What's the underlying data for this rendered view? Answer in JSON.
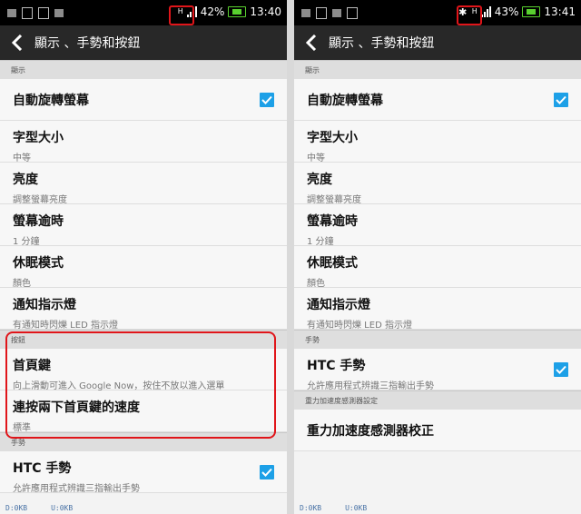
{
  "left": {
    "status": {
      "battery": "42%",
      "time": "13:40",
      "network_glyph": "H"
    },
    "title": "顯示 、手勢和按鈕",
    "sections": [
      {
        "header": "顯示",
        "rows": [
          {
            "title": "自動旋轉螢幕",
            "sub": null,
            "checkbox": true
          },
          {
            "title": "字型大小",
            "sub": "中等"
          },
          {
            "title": "亮度",
            "sub": "調整螢幕亮度"
          },
          {
            "title": "螢幕逾時",
            "sub": "1 分鐘"
          },
          {
            "title": "休眠模式",
            "sub": "顏色"
          },
          {
            "title": "通知指示燈",
            "sub": "有通知時閃爍 LED 指示燈"
          }
        ]
      },
      {
        "header": "按鈕",
        "rows": [
          {
            "title": "首頁鍵",
            "sub": "向上滑動可進入 Google Now，按住不放以進入選單"
          },
          {
            "title": "連按兩下首頁鍵的速度",
            "sub": "標準"
          }
        ]
      },
      {
        "header": "手勢",
        "rows": [
          {
            "title": "HTC 手勢",
            "sub": "允許應用程式辨識三指輸出手勢",
            "checkbox": true
          }
        ]
      }
    ],
    "footer": {
      "down": "D:0KB",
      "up": "U:0KB"
    }
  },
  "right": {
    "status": {
      "battery": "43%",
      "time": "13:41",
      "network_glyph": "H",
      "bluetooth_glyph": "✱"
    },
    "title": "顯示 、手勢和按鈕",
    "sections": [
      {
        "header": "顯示",
        "rows": [
          {
            "title": "自動旋轉螢幕",
            "sub": null,
            "checkbox": true
          },
          {
            "title": "字型大小",
            "sub": "中等"
          },
          {
            "title": "亮度",
            "sub": "調整螢幕亮度"
          },
          {
            "title": "螢幕逾時",
            "sub": "1 分鐘"
          },
          {
            "title": "休眠模式",
            "sub": "顏色"
          },
          {
            "title": "通知指示燈",
            "sub": "有通知時閃爍 LED 指示燈"
          }
        ]
      },
      {
        "header": "手勢",
        "rows": [
          {
            "title": "HTC 手勢",
            "sub": "允許應用程式辨識三指輸出手勢",
            "checkbox": true
          }
        ]
      },
      {
        "header": "重力加速度感測器設定",
        "rows": [
          {
            "title": "重力加速度感測器校正",
            "sub": null
          }
        ]
      }
    ],
    "footer": {
      "down": "D:0KB",
      "up": "U:0KB"
    }
  },
  "colors": {
    "checkbox": "#1da0e7",
    "highlight": "#e0151a",
    "actionbar": "#282828",
    "battery": "#59d02f"
  },
  "icons": {
    "back": "chevron-left-icon",
    "check": "checkmark-icon",
    "bluetooth": "bluetooth-icon"
  }
}
